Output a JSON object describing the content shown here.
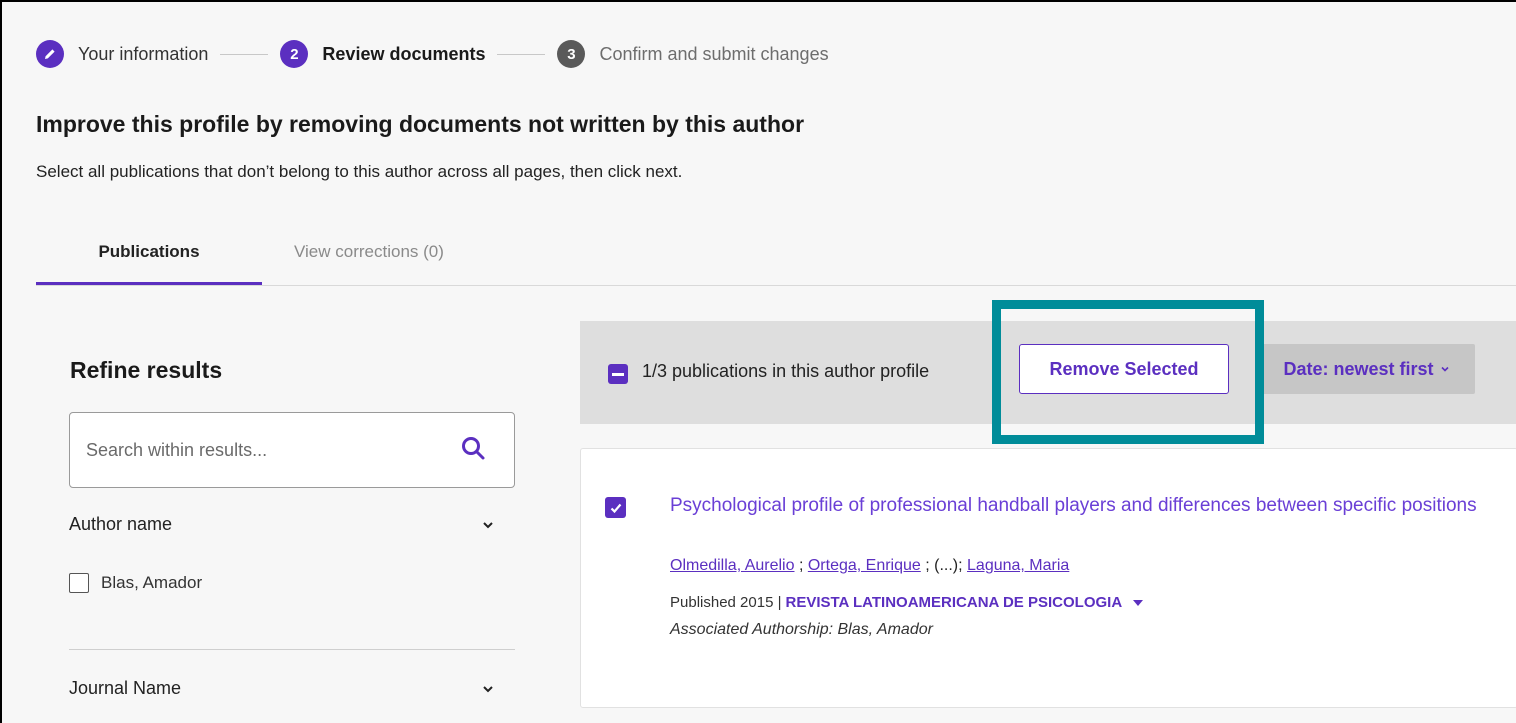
{
  "stepper": {
    "steps": [
      {
        "number": "",
        "label": "Your information"
      },
      {
        "number": "2",
        "label": "Review documents"
      },
      {
        "number": "3",
        "label": "Confirm and submit changes"
      }
    ]
  },
  "page": {
    "title": "Improve this profile by removing documents not written by this author",
    "subtitle": "Select all publications that don’t belong to this author across all pages, then click next."
  },
  "tabs": [
    {
      "label": "Publications"
    },
    {
      "label": "View corrections (0)"
    }
  ],
  "sidebar": {
    "title": "Refine results",
    "search_placeholder": "Search within results...",
    "facets": [
      {
        "label": "Author name",
        "options": [
          {
            "label": "Blas, Amador"
          }
        ]
      },
      {
        "label": "Journal Name"
      }
    ]
  },
  "results": {
    "count_text": "1/3 publications in this author profile",
    "remove_label": "Remove Selected",
    "sort_label": "Date: newest first",
    "items": [
      {
        "title": "Psychological profile of professional handball players and differences between specific positions",
        "authors": [
          "Olmedilla, Aurelio",
          "Ortega, Enrique",
          "Laguna, Maria"
        ],
        "author_sep1": " ; ",
        "author_sep2": " ; (...); ",
        "published": "Published 2015 |",
        "journal": "REVISTA LATINOAMERICANA DE PSICOLOGIA",
        "associated": "Associated Authorship: Blas, Amador"
      }
    ]
  },
  "colors": {
    "accent": "#5b2fc0",
    "highlight": "#008c99"
  }
}
